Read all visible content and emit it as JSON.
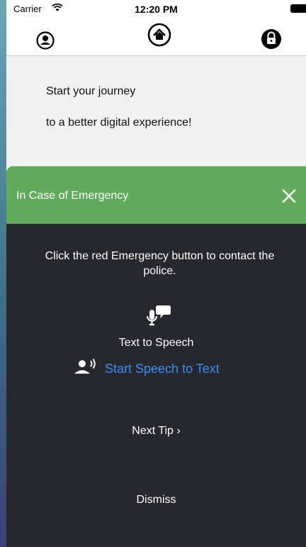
{
  "status_bar": {
    "carrier": "Carrier",
    "time": "12:20 PM",
    "wifi_icon": "wifi-icon",
    "battery_icon": "battery-icon"
  },
  "nav": {
    "profile_icon": "user-circle-icon",
    "home_icon": "home-circle-icon",
    "lock_icon": "lock-icon"
  },
  "intro": {
    "line1": "Start your journey",
    "line2": "to a better digital experience!"
  },
  "emergency_sheet": {
    "title": "In Case of Emergency",
    "close_icon": "close-icon",
    "tip": "Click the red Emergency button to contact the police.",
    "mic_icon": "microphone-speech-icon",
    "tts_label": "Text to Speech",
    "stt_icon": "speaking-person-icon",
    "stt_label": "Start Speech to Text",
    "next_tip": "Next Tip ›",
    "dismiss": "Dismiss"
  },
  "colors": {
    "header_green": "#62aa5c",
    "sheet_dark": "#26282d",
    "link_blue": "#3b8cf2",
    "content_bg": "#f1f1f1"
  }
}
